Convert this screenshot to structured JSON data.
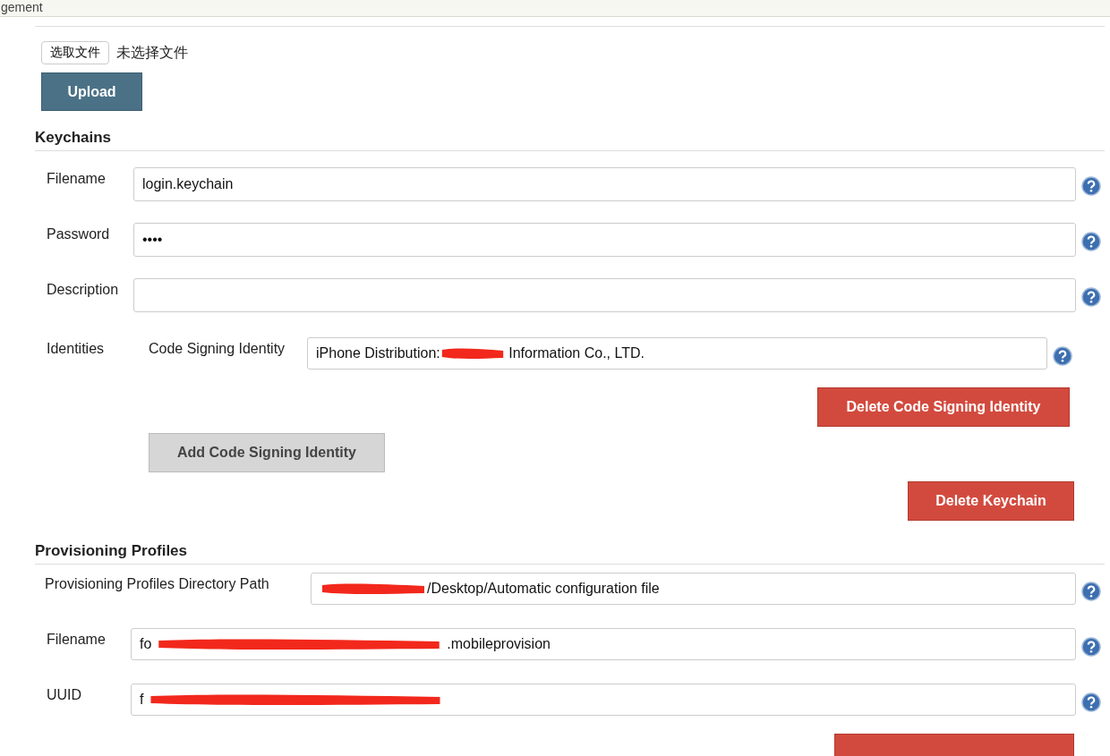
{
  "top_bar": {
    "text": "gement"
  },
  "upload_section": {
    "file_button": "选取文件",
    "file_status": "未选择文件",
    "upload_button": "Upload"
  },
  "keychains": {
    "title": "Keychains",
    "fields": [
      {
        "label": "Filename",
        "value": "login.keychain"
      },
      {
        "label": "Password",
        "value": "••••"
      },
      {
        "label": "Description"
      }
    ],
    "identities_label": "Identities",
    "identity": {
      "label": "Code Signing Identity",
      "value_start": "iPhone Distribution:",
      "redacted": true,
      "value_end": " Information Co., LTD."
    },
    "delete_identity_button": "Delete Code Signing Identity",
    "add_identity_button": "Add Code Signing Identity",
    "delete_keychain_button": "Delete Keychain"
  },
  "provisioning": {
    "title": "Provisioning Profiles",
    "fields": [
      {
        "label": "Provisioning Profiles Directory Path",
        "redacted": true,
        "value_end": "/Desktop/Automatic configuration file"
      },
      {
        "label": "Filename",
        "value_start": "fo",
        "redacted": true,
        "value_end": ".mobileprovision"
      },
      {
        "label": "UUID",
        "value_start": "f",
        "redacted": true
      }
    ]
  }
}
